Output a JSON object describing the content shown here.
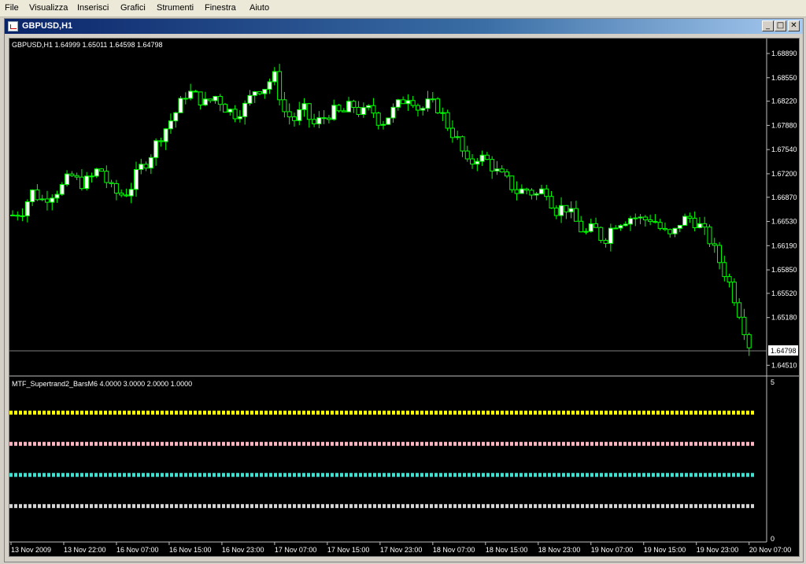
{
  "menu": [
    "File",
    "Visualizza",
    "Inserisci",
    "Grafici",
    "Strumenti",
    "Finestra",
    "Aiuto"
  ],
  "window": {
    "title": "GBPUSD,H1"
  },
  "main_panel": {
    "info": "GBPUSD,H1  1.64999 1.65011 1.64598 1.64798"
  },
  "indicator_panel": {
    "label": "MTF_Supertrand2_BarsM6 4.0000 3.0000 2.0000 1.0000",
    "scale_top": "5",
    "scale_bottom": "0"
  },
  "current_price": "1.64798",
  "colors": {
    "bull": "#ffffff",
    "bear": "#000000",
    "wick": "#00ff00",
    "grid": "#808080",
    "line_yellow": "#ffff00",
    "line_pink": "#ffb6c1",
    "line_cyan": "#40e0d0",
    "line_white": "#d3d3d3"
  },
  "chart_data": [
    {
      "type": "candlestick",
      "title": "GBPUSD,H1",
      "y_ticks": [
        "1.68890",
        "1.68550",
        "1.68220",
        "1.67880",
        "1.67540",
        "1.67200",
        "1.66870",
        "1.66530",
        "1.66190",
        "1.65850",
        "1.65520",
        "1.65180",
        "1.64510"
      ],
      "x_ticks": [
        "13 Nov 2009",
        "13 Nov 22:00",
        "16 Nov 07:00",
        "16 Nov 15:00",
        "16 Nov 23:00",
        "17 Nov 07:00",
        "17 Nov 15:00",
        "17 Nov 23:00",
        "18 Nov 07:00",
        "18 Nov 15:00",
        "18 Nov 23:00",
        "19 Nov 07:00",
        "19 Nov 15:00",
        "19 Nov 23:00",
        "20 Nov 07:00"
      ],
      "ylim": [
        1.6437,
        1.691
      ],
      "series_close_path": [
        1.6662,
        1.6668,
        1.6695,
        1.6683,
        1.6692,
        1.67,
        1.6718,
        1.6706,
        1.6712,
        1.673,
        1.67,
        1.669,
        1.6695,
        1.6725,
        1.674,
        1.6768,
        1.6788,
        1.681,
        1.6836,
        1.6828,
        1.6818,
        1.683,
        1.6812,
        1.6804,
        1.6815,
        1.6838,
        1.6842,
        1.6858,
        1.6808,
        1.6795,
        1.6812,
        1.6788,
        1.6798,
        1.6808,
        1.6804,
        1.6818,
        1.6804,
        1.6812,
        1.679,
        1.6805,
        1.682,
        1.6832,
        1.6808,
        1.682,
        1.6812,
        1.6785,
        1.6765,
        1.673,
        1.6745,
        1.6738,
        1.6722,
        1.671,
        1.6695,
        1.6698,
        1.669,
        1.67,
        1.6668,
        1.6675,
        1.6655,
        1.6635,
        1.6645,
        1.6625,
        1.665,
        1.6655,
        1.666,
        1.6655,
        1.6658,
        1.664,
        1.663,
        1.6655,
        1.6658,
        1.6645,
        1.6625,
        1.6595,
        1.6565,
        1.6525,
        1.648
      ]
    },
    {
      "type": "line",
      "title": "MTF_Supertrand2_BarsM6 4.0000 3.0000 2.0000 1.0000",
      "ylim": [
        0,
        5
      ],
      "series": [
        {
          "name": "4.0000",
          "values": [
            4,
            4
          ]
        },
        {
          "name": "3.0000",
          "values": [
            3,
            3
          ]
        },
        {
          "name": "2.0000",
          "values": [
            2,
            2
          ]
        },
        {
          "name": "1.0000",
          "values": [
            1,
            1
          ]
        }
      ]
    }
  ]
}
